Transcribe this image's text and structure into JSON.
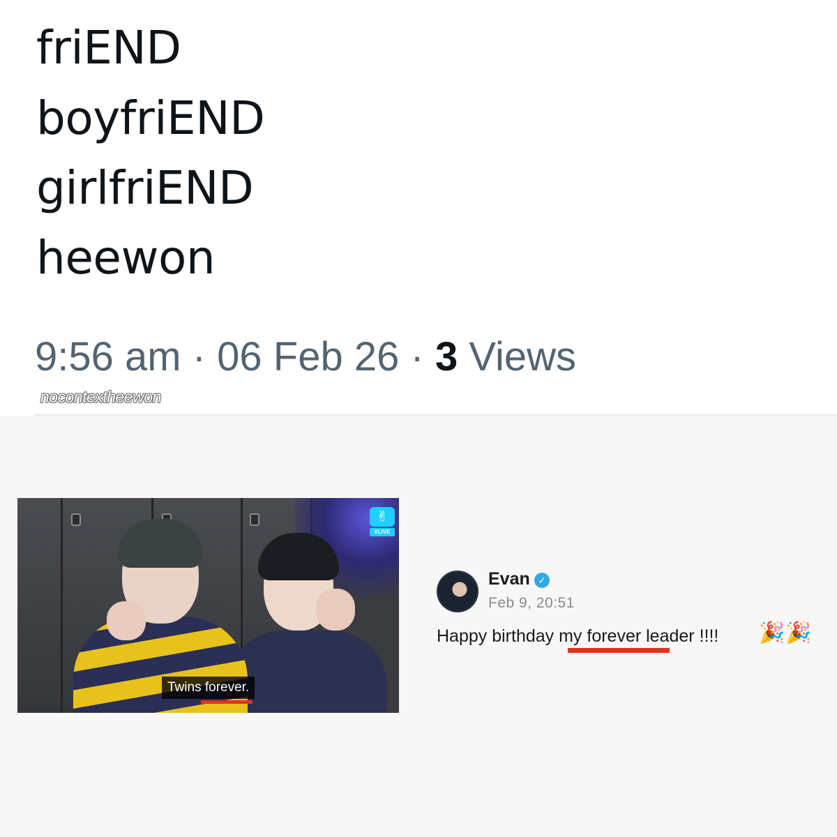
{
  "tweet": {
    "lines": [
      "friEND",
      "boyfriEND",
      "girlfriEND",
      "heewon"
    ],
    "time": "9:56 am",
    "separator": "·",
    "date": "06 Feb 26",
    "views_count": "3",
    "views_label": "Views"
  },
  "watermark": "nocontextheewon",
  "video": {
    "caption": "Twins forever.",
    "logo_text": "VLIVE"
  },
  "post": {
    "author": "Evan",
    "date": "Feb 9, 20:51",
    "text": "Happy birthday my forever leader !!!!",
    "emoji": "🎉"
  },
  "colors": {
    "meta_gray": "#536471",
    "highlight_red": "#e5321b",
    "verified_blue": "#31a8e0",
    "vlive_cyan": "#1ecfff"
  }
}
